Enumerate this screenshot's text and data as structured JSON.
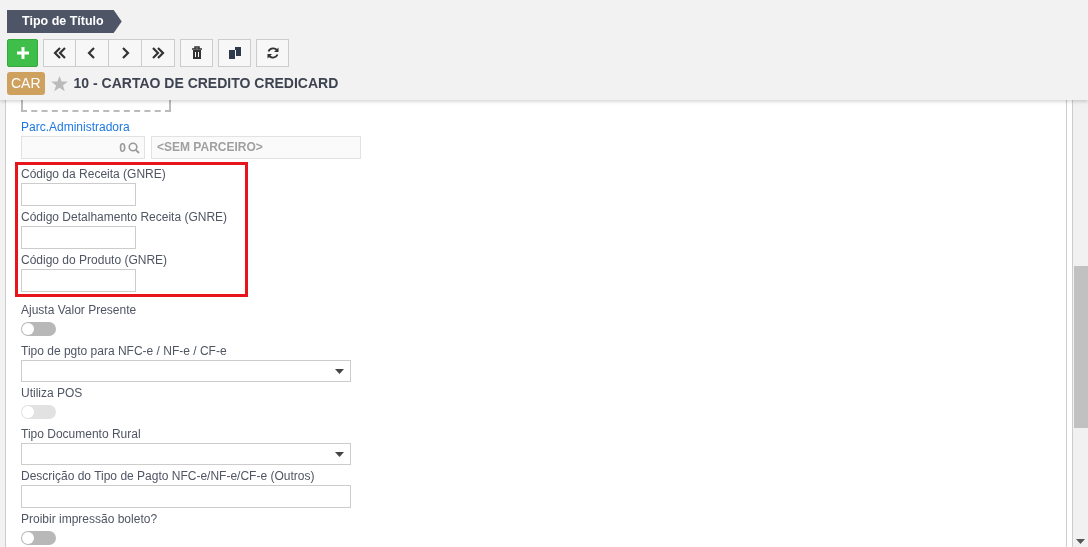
{
  "breadcrumb": "Tipo de Título",
  "toolbar": [
    {
      "kind": "add"
    },
    {
      "kind": "first"
    },
    {
      "kind": "prev"
    },
    {
      "kind": "next"
    },
    {
      "kind": "last"
    },
    {
      "kind": "delete"
    },
    {
      "kind": "copy"
    },
    {
      "kind": "refresh"
    }
  ],
  "record": {
    "badge": "CAR",
    "favorite": false,
    "title": "10 - CARTAO DE CREDITO CREDICARD"
  },
  "fields": [
    {
      "kind": "lookup",
      "label": "Parc.Administradora",
      "code": "0",
      "name": "<SEM PARCEIRO>"
    },
    {
      "kind": "highlight_group",
      "fields": [
        {
          "kind": "short_text",
          "label": "Código da Receita (GNRE)"
        },
        {
          "kind": "short_text",
          "label": "Código Detalhamento Receita (GNRE)"
        },
        {
          "kind": "short_text",
          "label": "Código do Produto (GNRE)"
        }
      ]
    },
    {
      "kind": "toggle",
      "label": "Ajusta Valor Presente",
      "on": false,
      "disabled": false
    },
    {
      "kind": "select",
      "label": "Tipo de pgto para NFC-e / NF-e / CF-e"
    },
    {
      "kind": "toggle",
      "label": "Utiliza POS",
      "on": false,
      "disabled": true
    },
    {
      "kind": "select",
      "label": "Tipo Documento Rural"
    },
    {
      "kind": "text",
      "label": "Descrição do Tipo de Pagto NFC-e/NF-e/CF-e (Outros)"
    },
    {
      "kind": "toggle",
      "label": "Proibir impressão boleto?",
      "on": false,
      "disabled": false
    }
  ]
}
